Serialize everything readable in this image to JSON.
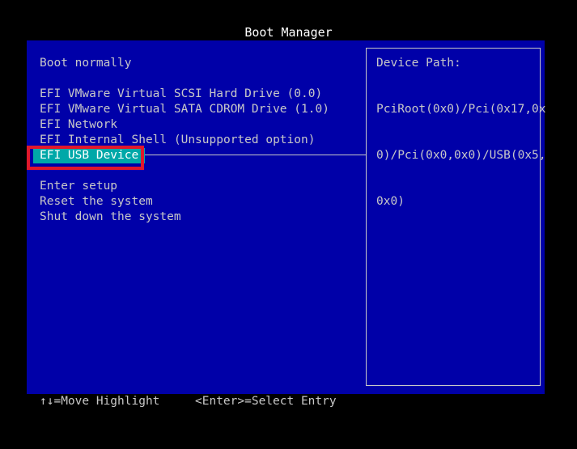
{
  "header": {
    "title": "Boot Manager"
  },
  "menu": {
    "items": [
      {
        "label": "Boot normally"
      },
      {
        "label": "EFI VMware Virtual SCSI Hard Drive (0.0)"
      },
      {
        "label": "EFI VMware Virtual SATA CDROM Drive (1.0)"
      },
      {
        "label": "EFI Network"
      },
      {
        "label": "EFI Internal Shell (Unsupported option)"
      },
      {
        "label": "EFI USB Device",
        "selected": true
      },
      {
        "label": "Enter setup"
      },
      {
        "label": "Reset the system"
      },
      {
        "label": "Shut down the system"
      }
    ]
  },
  "details": {
    "label": "Device Path:",
    "value_lines": [
      "PciRoot(0x0)/Pci(0x17,0x",
      "0)/Pci(0x0,0x0)/USB(0x5,",
      "0x0)"
    ]
  },
  "footer": {
    "move_hint": "↑↓=Move Highlight",
    "select_hint": "<Enter>=Select Entry"
  },
  "colors": {
    "background": "#0000a8",
    "selection": "#00a8a8",
    "annotation_box": "#e0182c"
  }
}
